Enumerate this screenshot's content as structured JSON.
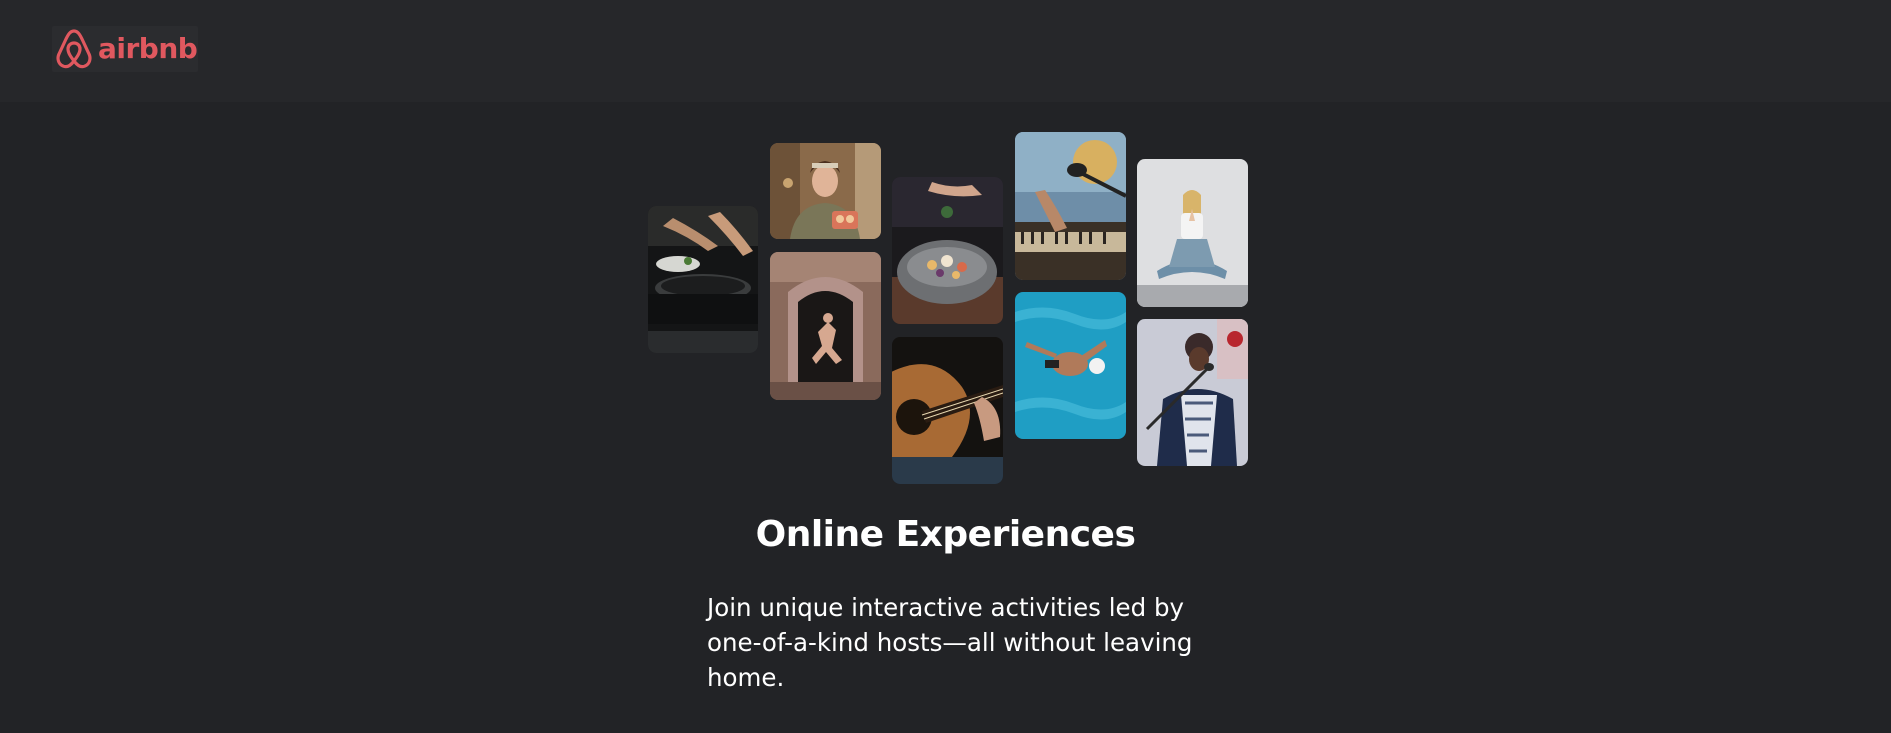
{
  "header": {
    "brand_name": "airbnb",
    "brand_color": "#e0585f",
    "logo_icon": "airbnb-belo-icon"
  },
  "gallery": {
    "photos": [
      {
        "name": "photo-cooking-pan",
        "subject": "cooking-icon"
      },
      {
        "name": "photo-woman-holding-cookies",
        "subject": "baking-icon"
      },
      {
        "name": "photo-dancer-in-doorway",
        "subject": "dance-icon"
      },
      {
        "name": "photo-food-bowl",
        "subject": "food-icon"
      },
      {
        "name": "photo-guitar",
        "subject": "guitar-icon"
      },
      {
        "name": "photo-keyboard-microphone",
        "subject": "music-icon"
      },
      {
        "name": "photo-swimmer",
        "subject": "swimming-icon"
      },
      {
        "name": "photo-yoga",
        "subject": "yoga-icon"
      },
      {
        "name": "photo-singer",
        "subject": "singing-icon"
      }
    ]
  },
  "main": {
    "title": "Online Experiences",
    "description": "Join unique interactive activities led by one-of-a-kind hosts—all without leaving home."
  },
  "colors": {
    "page_background": "#222326",
    "header_background": "#26272a",
    "text": "#ffffff"
  }
}
